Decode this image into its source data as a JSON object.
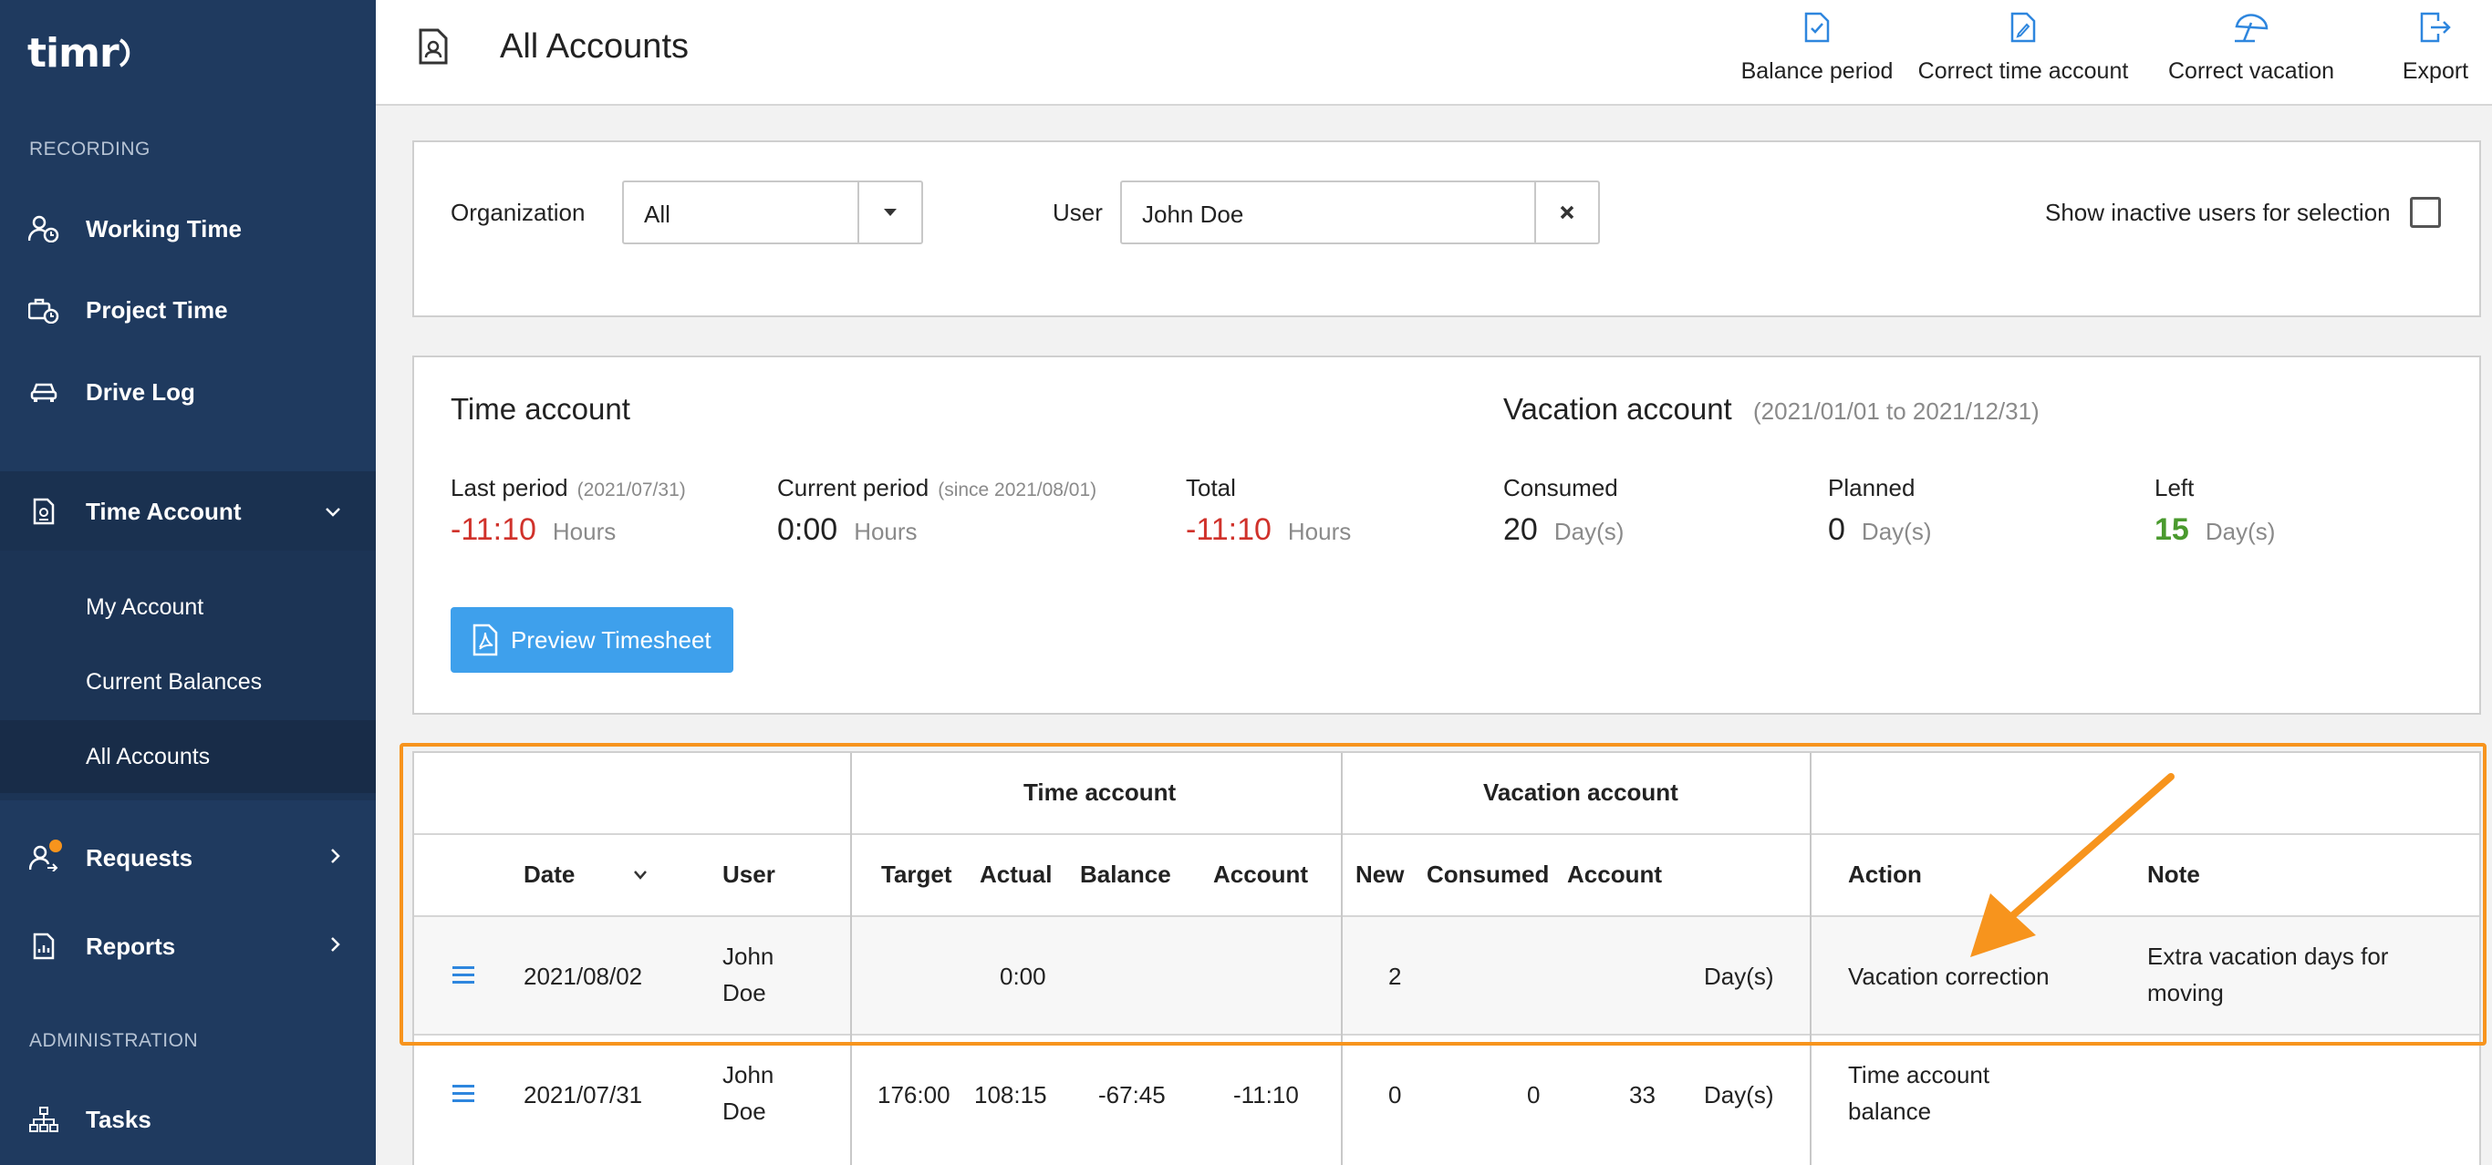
{
  "app": {
    "logo_text": "timr"
  },
  "sidebar": {
    "recording_label": "RECORDING",
    "admin_label": "ADMINISTRATION",
    "items": [
      {
        "label": "Working Time",
        "icon": "user-clock-icon"
      },
      {
        "label": "Project Time",
        "icon": "briefcase-clock-icon"
      },
      {
        "label": "Drive Log",
        "icon": "car-icon"
      },
      {
        "label": "Time Account",
        "icon": "document-icon"
      },
      {
        "label": "Requests",
        "icon": "user-request-icon"
      },
      {
        "label": "Reports",
        "icon": "report-icon"
      },
      {
        "label": "Tasks",
        "icon": "hierarchy-icon"
      }
    ],
    "sub_items": [
      {
        "label": "My Account"
      },
      {
        "label": "Current Balances"
      },
      {
        "label": "All Accounts"
      }
    ]
  },
  "header": {
    "title": "All Accounts",
    "actions": [
      {
        "label": "Balance period",
        "icon": "doc-check-icon"
      },
      {
        "label": "Correct time account",
        "icon": "doc-edit-icon"
      },
      {
        "label": "Correct vacation",
        "icon": "umbrella-icon"
      },
      {
        "label": "Export",
        "icon": "export-icon"
      }
    ]
  },
  "filters": {
    "organization_label": "Organization",
    "organization_value": "All",
    "user_label": "User",
    "user_value": "John Doe",
    "inactive_label": "Show inactive users for selection"
  },
  "summary": {
    "time_title": "Time account",
    "vacation_title": "Vacation account",
    "vacation_range": "(2021/01/01 to 2021/12/31)",
    "last_period_label": "Last period",
    "last_period_date": "(2021/07/31)",
    "last_period_value": "-11:10",
    "current_period_label": "Current period",
    "current_period_date": "(since 2021/08/01)",
    "current_period_value": "0:00",
    "total_label": "Total",
    "total_value": "-11:10",
    "hours_unit": "Hours",
    "consumed_label": "Consumed",
    "consumed_value": "20",
    "planned_label": "Planned",
    "planned_value": "0",
    "left_label": "Left",
    "left_value": "15",
    "days_unit": "Day(s)",
    "preview_button": "Preview Timesheet"
  },
  "table": {
    "group_time": "Time account",
    "group_vacation": "Vacation account",
    "headers": {
      "date": "Date",
      "user": "User",
      "target": "Target",
      "actual": "Actual",
      "balance": "Balance",
      "account": "Account",
      "new": "New",
      "consumed": "Consumed",
      "vac_account": "Account",
      "action": "Action",
      "note": "Note"
    },
    "rows": [
      {
        "date": "2021/08/02",
        "user_first": "John",
        "user_last": "Doe",
        "target": "",
        "actual": "0:00",
        "balance": "",
        "account": "",
        "new": "2",
        "consumed": "",
        "vac_account": "",
        "unit": "Day(s)",
        "action_line1": "Vacation correction",
        "action_line2": "",
        "note_line1": "Extra vacation days for",
        "note_line2": "moving"
      },
      {
        "date": "2021/07/31",
        "user_first": "John",
        "user_last": "Doe",
        "target": "176:00",
        "actual": "108:15",
        "balance": "-67:45",
        "account": "-11:10",
        "new": "0",
        "consumed": "0",
        "vac_account": "33",
        "unit": "Day(s)",
        "action_line1": "Time account",
        "action_line2": "balance",
        "note_line1": "",
        "note_line2": ""
      }
    ]
  },
  "colors": {
    "sidebar_bg": "#1f3a5f",
    "accent_blue": "#3ea0ec",
    "negative_red": "#d0322b",
    "positive_green": "#4a9a2e",
    "highlight_orange": "#f7941d"
  }
}
